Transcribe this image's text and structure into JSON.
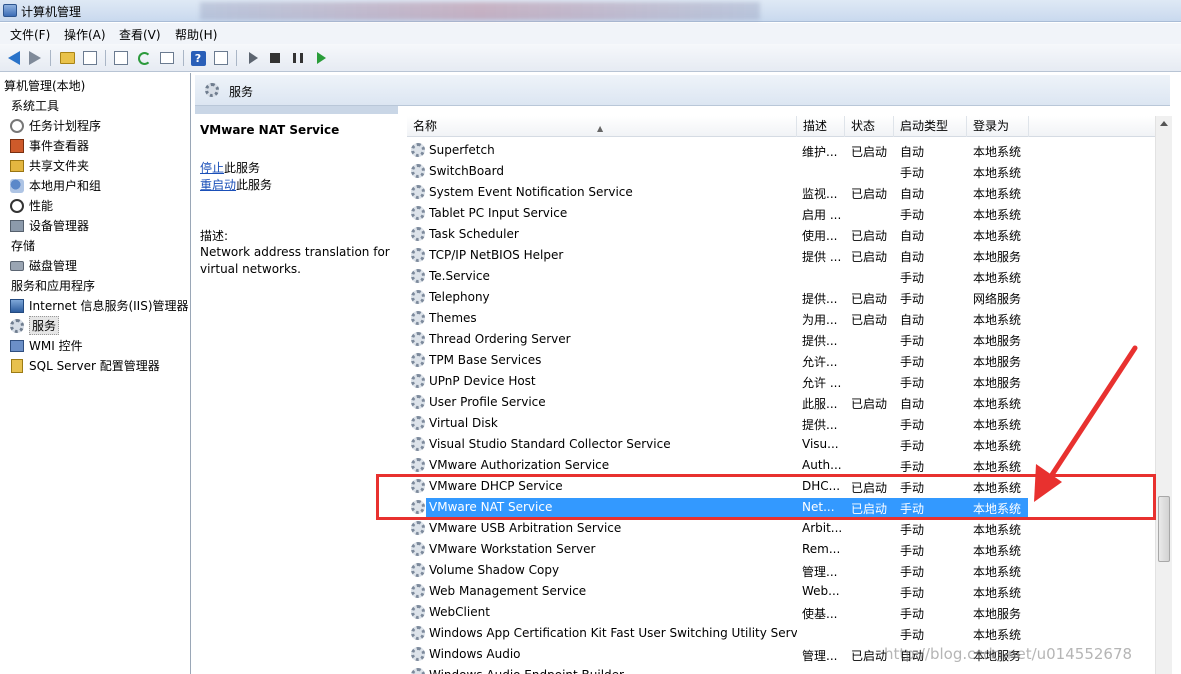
{
  "window": {
    "title": "计算机管理"
  },
  "menu": [
    "文件(F)",
    "操作(A)",
    "查看(V)",
    "帮助(H)"
  ],
  "toolbar": {
    "icons": [
      "back-icon",
      "forward-icon",
      "up-folder-icon",
      "show-hide-tree-icon",
      "properties-icon",
      "refresh-icon",
      "export-icon",
      "help-icon",
      "show-pane-icon",
      "start-icon",
      "stop-icon",
      "pause-icon",
      "resume-icon"
    ],
    "help_glyph": "?"
  },
  "tree": [
    {
      "label": "算机管理(本地)",
      "icon": "",
      "indent": 0
    },
    {
      "label": "系统工具",
      "icon": "",
      "indent": 1
    },
    {
      "label": "任务计划程序",
      "icon": "clock-icon",
      "indent": 2
    },
    {
      "label": "事件查看器",
      "icon": "event-viewer-icon",
      "indent": 2
    },
    {
      "label": "共享文件夹",
      "icon": "shared-folder-icon",
      "indent": 2
    },
    {
      "label": "本地用户和组",
      "icon": "users-icon",
      "indent": 2
    },
    {
      "label": "性能",
      "icon": "performance-icon",
      "indent": 2
    },
    {
      "label": "设备管理器",
      "icon": "device-manager-icon",
      "indent": 2
    },
    {
      "label": "存储",
      "icon": "",
      "indent": 1
    },
    {
      "label": "磁盘管理",
      "icon": "disk-icon",
      "indent": 2
    },
    {
      "label": "服务和应用程序",
      "icon": "",
      "indent": 1
    },
    {
      "label": "Internet 信息服务(IIS)管理器",
      "icon": "iis-icon",
      "indent": 2
    },
    {
      "label": "服务",
      "icon": "gear-icon",
      "indent": 2,
      "selected": true
    },
    {
      "label": "WMI 控件",
      "icon": "wmi-icon",
      "indent": 2
    },
    {
      "label": "SQL Server 配置管理器",
      "icon": "sql-server-icon",
      "indent": 2
    }
  ],
  "pane": {
    "title": "服务"
  },
  "detail": {
    "service_name": "VMware NAT Service",
    "stop_link": "停止",
    "stop_suffix": "此服务",
    "restart_link": "重启动",
    "restart_suffix": "此服务",
    "desc_label": "描述:",
    "desc_text": "Network address translation for virtual networks."
  },
  "columns": [
    "名称",
    "描述",
    "状态",
    "启动类型",
    "登录为"
  ],
  "services": [
    [
      "Superfetch",
      "维护...",
      "已启动",
      "自动",
      "本地系统"
    ],
    [
      "SwitchBoard",
      "",
      "",
      "手动",
      "本地系统"
    ],
    [
      "System Event Notification Service",
      "监视...",
      "已启动",
      "自动",
      "本地系统"
    ],
    [
      "Tablet PC Input Service",
      "启用 ...",
      "",
      "手动",
      "本地系统"
    ],
    [
      "Task Scheduler",
      "使用...",
      "已启动",
      "自动",
      "本地系统"
    ],
    [
      "TCP/IP NetBIOS Helper",
      "提供 ...",
      "已启动",
      "自动",
      "本地服务"
    ],
    [
      "Te.Service",
      "",
      "",
      "手动",
      "本地系统"
    ],
    [
      "Telephony",
      "提供...",
      "已启动",
      "手动",
      "网络服务"
    ],
    [
      "Themes",
      "为用...",
      "已启动",
      "自动",
      "本地系统"
    ],
    [
      "Thread Ordering Server",
      "提供...",
      "",
      "手动",
      "本地服务"
    ],
    [
      "TPM Base Services",
      "允许...",
      "",
      "手动",
      "本地服务"
    ],
    [
      "UPnP Device Host",
      "允许 ...",
      "",
      "手动",
      "本地服务"
    ],
    [
      "User Profile Service",
      "此服...",
      "已启动",
      "自动",
      "本地系统"
    ],
    [
      "Virtual Disk",
      "提供...",
      "",
      "手动",
      "本地系统"
    ],
    [
      "Visual Studio Standard Collector Service",
      "Visu...",
      "",
      "手动",
      "本地系统"
    ],
    [
      "VMware Authorization Service",
      "Auth...",
      "",
      "手动",
      "本地系统"
    ],
    [
      "VMware DHCP Service",
      "DHC...",
      "已启动",
      "手动",
      "本地系统"
    ],
    [
      "VMware NAT Service",
      "Net...",
      "已启动",
      "手动",
      "本地系统"
    ],
    [
      "VMware USB Arbitration Service",
      "Arbit...",
      "",
      "手动",
      "本地系统"
    ],
    [
      "VMware Workstation Server",
      "Rem...",
      "",
      "手动",
      "本地系统"
    ],
    [
      "Volume Shadow Copy",
      "管理...",
      "",
      "手动",
      "本地系统"
    ],
    [
      "Web Management Service",
      "Web...",
      "",
      "手动",
      "本地系统"
    ],
    [
      "WebClient",
      "使基...",
      "",
      "手动",
      "本地服务"
    ],
    [
      "Windows App Certification Kit Fast User Switching Utility Serv...",
      "",
      "",
      "手动",
      "本地系统"
    ],
    [
      "Windows Audio",
      "管理...",
      "已启动",
      "自动",
      "本地服务"
    ],
    [
      "Windows Audio Endpoint Builder",
      "",
      "",
      "",
      ""
    ]
  ],
  "selected_service_index": 17,
  "watermark": "http://blog.csdn.net/u014552678",
  "colors": {
    "selection": "#3399ff",
    "annotation": "#e8312f",
    "link": "#1a4fb8"
  }
}
